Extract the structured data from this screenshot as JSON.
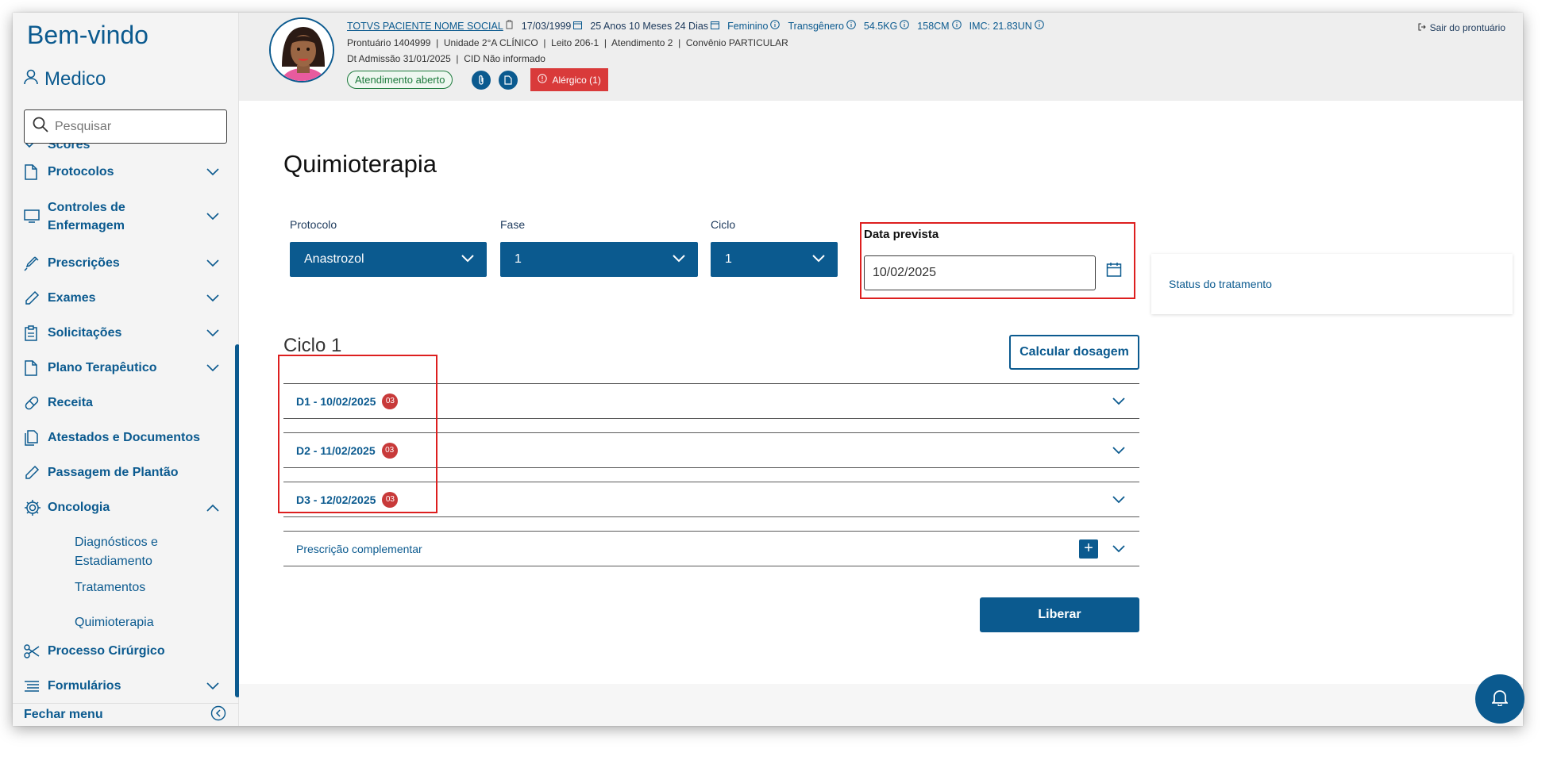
{
  "sidebar": {
    "welcome": "Bem-vindo",
    "user": "Medico",
    "search_placeholder": "Pesquisar",
    "items": [
      {
        "label": "Scores"
      },
      {
        "label": "Protocolos"
      },
      {
        "label": "Controles de Enfermagem"
      },
      {
        "label": "Prescrições"
      },
      {
        "label": "Exames"
      },
      {
        "label": "Solicitações"
      },
      {
        "label": "Plano Terapêutico"
      },
      {
        "label": "Receita"
      },
      {
        "label": "Atestados e Documentos"
      },
      {
        "label": "Passagem de Plantão"
      },
      {
        "label": "Oncologia"
      },
      {
        "label": "Processo Cirúrgico"
      },
      {
        "label": "Formulários"
      }
    ],
    "oncologia_sub": [
      "Diagnósticos e Estadiamento",
      "Tratamentos",
      "Quimioterapia"
    ],
    "footer": "Fechar menu"
  },
  "header": {
    "patient_name": "TOTVS PACIENTE NOME SOCIAL",
    "birth_date": "17/03/1999",
    "age": "25 Anos 10 Meses 24 Dias",
    "gender": "Feminino",
    "identity": "Transgênero",
    "weight": "54.5KG",
    "height": "158CM",
    "imc": "IMC: 21.83UN",
    "line2": "Prontuário 1404999  |  Unidade 2°A CLÍNICO  |  Leito 206-1  |  Atendimento 2  |  Convênio PARTICULAR",
    "line3": "Dt Admissão 31/01/2025  |  CID Não informado",
    "status_pill": "Atendimento aberto",
    "allergy": "Alérgico (1)",
    "exit": "Sair do prontuário"
  },
  "main": {
    "title": "Quimioterapia",
    "protocolo_label": "Protocolo",
    "protocolo_value": "Anastrozol",
    "fase_label": "Fase",
    "fase_value": "1",
    "ciclo_label": "Ciclo",
    "ciclo_value": "1",
    "data_label": "Data prevista",
    "data_value": "10/02/2025",
    "status_title": "Status do tratamento",
    "ciclo_title": "Ciclo 1",
    "calc_button": "Calcular dosagem",
    "days": [
      {
        "label": "D1 - 10/02/2025",
        "count": "03"
      },
      {
        "label": "D2 - 11/02/2025",
        "count": "03"
      },
      {
        "label": "D3 - 12/02/2025",
        "count": "03"
      }
    ],
    "complementar": "Prescrição complementar",
    "liberar": "Liberar"
  }
}
